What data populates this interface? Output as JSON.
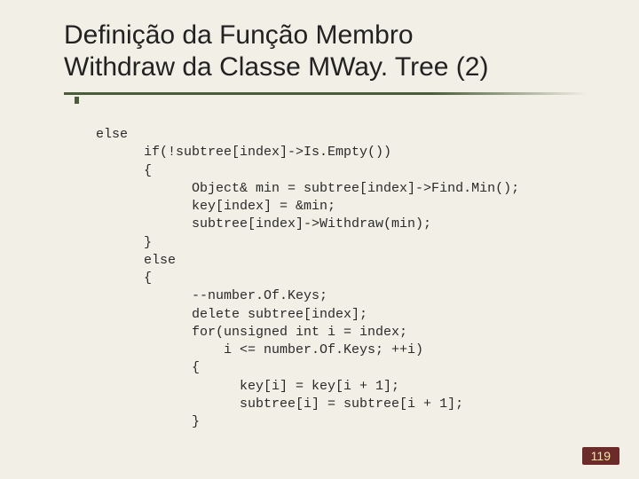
{
  "title_line1": "Definição da Função Membro",
  "title_line2": "Withdraw da Classe MWay. Tree (2)",
  "code": {
    "l01": "else",
    "l02": "      if(!subtree[index]->Is.Empty())",
    "l03": "      {",
    "l04": "            Object& min = subtree[index]->Find.Min();",
    "l05": "            key[index] = &min;",
    "l06": "            subtree[index]->Withdraw(min);",
    "l07": "      }",
    "l08": "      else",
    "l09": "      {",
    "l10": "            --number.Of.Keys;",
    "l11": "            delete subtree[index];",
    "l12": "            for(unsigned int i = index;",
    "l13": "                i <= number.Of.Keys; ++i)",
    "l14": "            {",
    "l15": "                  key[i] = key[i + 1];",
    "l16": "                  subtree[i] = subtree[i + 1];",
    "l17": "            }"
  },
  "pagenum": "119"
}
